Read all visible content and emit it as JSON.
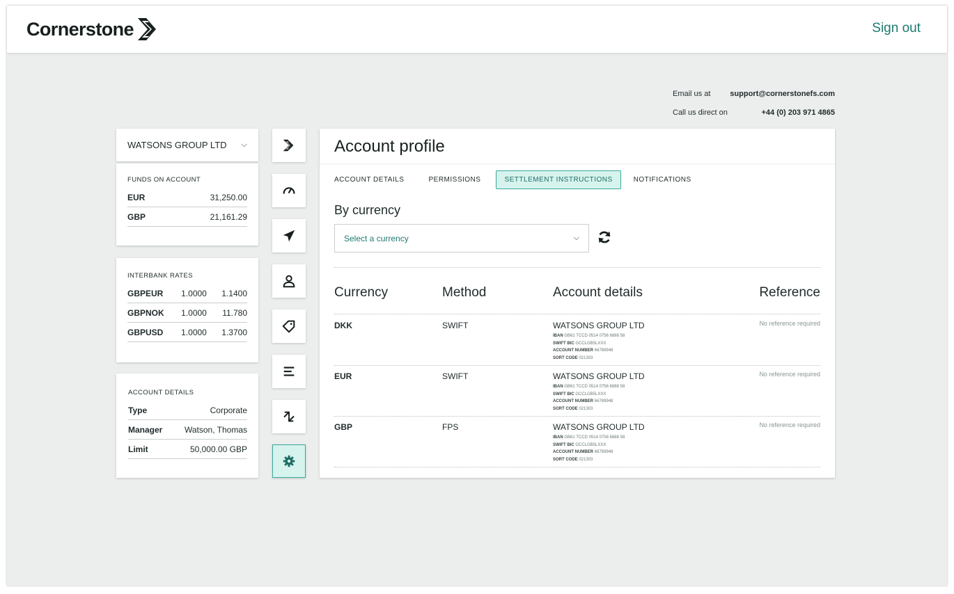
{
  "brand": {
    "name": "Cornerstone",
    "accent": "#1e7a70",
    "accent_light": "#d6f3ee"
  },
  "header": {
    "signout_label": "Sign out"
  },
  "contact": {
    "email_label": "Email us at",
    "email": "support@cornerstonefs.com",
    "phone_label": "Call us direct on",
    "phone": "+44 (0) 203 971 4865"
  },
  "company_selector": {
    "value": "WATSONS GROUP LTD"
  },
  "funds": {
    "title": "FUNDS ON ACCOUNT",
    "rows": [
      {
        "k": "EUR",
        "v": "31,250.00"
      },
      {
        "k": "GBP",
        "v": "21,161.29"
      }
    ]
  },
  "rates": {
    "title": "INTERBANK RATES",
    "rows": [
      {
        "pair": "GBPEUR",
        "a": "1.0000",
        "b": "1.1400"
      },
      {
        "pair": "GBPNOK",
        "a": "1.0000",
        "b": "11.780"
      },
      {
        "pair": "GBPUSD",
        "a": "1.0000",
        "b": "1.3700"
      }
    ]
  },
  "account_details": {
    "title": "ACCOUNT DETAILS",
    "rows": [
      {
        "k": "Type",
        "v": "Corporate"
      },
      {
        "k": "Manager",
        "v": "Watson, Thomas"
      },
      {
        "k": "Limit",
        "v": "50,000.00 GBP"
      }
    ]
  },
  "nav": {
    "items": [
      "logo-icon",
      "dashboard-icon",
      "send-icon",
      "user-icon",
      "tag-icon",
      "menu-icon",
      "exchange-icon",
      "settings-icon"
    ],
    "active": "settings-icon"
  },
  "main": {
    "title": "Account profile",
    "tabs": [
      {
        "label": "ACCOUNT DETAILS"
      },
      {
        "label": "PERMISSIONS"
      },
      {
        "label": "SETTLEMENT INSTRUCTIONS"
      },
      {
        "label": "NOTIFICATIONS"
      }
    ],
    "active_tab": "SETTLEMENT INSTRUCTIONS",
    "section_title": "By currency",
    "currency_select": {
      "placeholder": "Select a currency"
    },
    "table": {
      "headers": [
        "Currency",
        "Method",
        "Account details",
        "Reference"
      ],
      "rows": [
        {
          "currency": "DKK",
          "method": "SWIFT",
          "account_name": "WATSONS GROUP LTD",
          "iban_label": "IBAN",
          "iban": "GB61 TCCD 0514 0756 6888 58",
          "bic_label": "SWIFT BIC",
          "bic": "GCCLGB5LXXX",
          "acct_label": "ACCOUNT NUMBER",
          "acct": "66789948",
          "sort_label": "SORT CODE",
          "sort": "021303",
          "reference": "No reference required"
        },
        {
          "currency": "EUR",
          "method": "SWIFT",
          "account_name": "WATSONS GROUP LTD",
          "iban_label": "IBAN",
          "iban": "GB61 TCCD 0514 0756 6888 58",
          "bic_label": "SWIFT BIC",
          "bic": "GCCLGB5LXXX",
          "acct_label": "ACCOUNT NUMBER",
          "acct": "66789948",
          "sort_label": "SORT CODE",
          "sort": "021303",
          "reference": "No reference required"
        },
        {
          "currency": "GBP",
          "method": "FPS",
          "account_name": "WATSONS GROUP LTD",
          "iban_label": "IBAN",
          "iban": "GB61 TCCD 0514 0756 6888 58",
          "bic_label": "SWIFT BIC",
          "bic": "GCCLGB5LXXX",
          "acct_label": "ACCOUNT NUMBER",
          "acct": "66789948",
          "sort_label": "SORT CODE",
          "sort": "021303",
          "reference": "No reference required"
        }
      ]
    }
  }
}
